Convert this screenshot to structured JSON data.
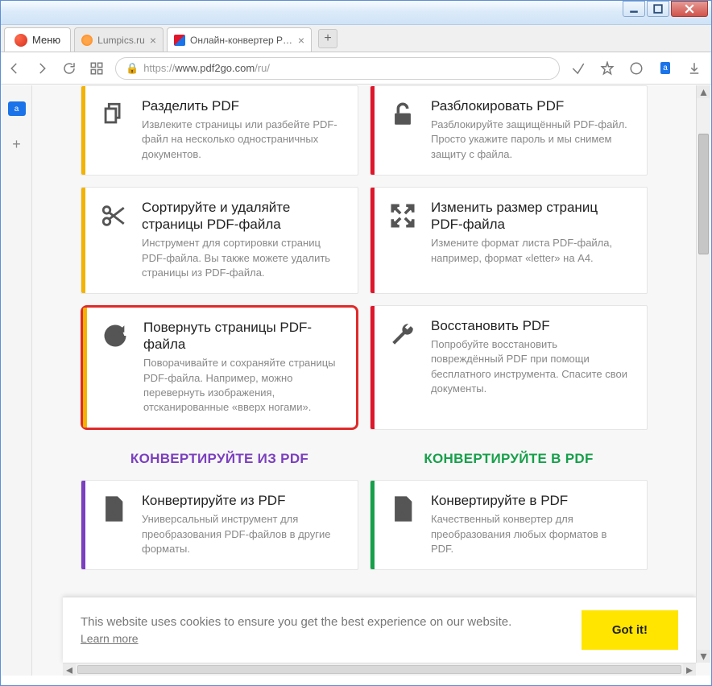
{
  "window": {
    "menu_label": "Меню"
  },
  "tabs": [
    {
      "title": "Lumpics.ru",
      "active": false
    },
    {
      "title": "Онлайн-конвертер PDF-д",
      "active": true
    }
  ],
  "address": {
    "scheme": "https://",
    "host": "www.pdf2go.com",
    "path": "/ru/"
  },
  "side_rail": {
    "badge": "a",
    "plus": "+"
  },
  "cards": [
    {
      "stripe": "#f4b300",
      "icon": "copy",
      "title": "Разделить PDF",
      "desc": "Извлеките страницы или разбейте PDF-файл на несколько одностраничных документов.",
      "highlight": false
    },
    {
      "stripe": "#e0162b",
      "icon": "unlock",
      "title": "Разблокировать PDF",
      "desc": "Разблокируйте защищённый PDF-файл. Просто укажите пароль и мы снимем защиту с файла.",
      "highlight": false
    },
    {
      "stripe": "#f4b300",
      "icon": "scissors",
      "title": "Сортируйте и удаляйте страницы PDF-файла",
      "desc": "Инструмент для сортировки страниц PDF-файла. Вы также можете удалить страницы из PDF-файла.",
      "highlight": false
    },
    {
      "stripe": "#e0162b",
      "icon": "expand",
      "title": "Изменить размер страниц PDF-файла",
      "desc": "Измените формат листа PDF-файла, например, формат «letter» на А4.",
      "highlight": false
    },
    {
      "stripe": "#f4b300",
      "icon": "rotate",
      "title": "Повернуть страницы PDF-файла",
      "desc": "Поворачивайте и сохраняйте страницы PDF-файла. Например, можно перевернуть изображения, отсканированные «вверх ногами».",
      "highlight": true
    },
    {
      "stripe": "#e0162b",
      "icon": "wrench",
      "title": "Восстановить PDF",
      "desc": "Попробуйте восстановить повреждённый PDF при помощи бесплатного инструмента. Спасите свои документы.",
      "highlight": false
    }
  ],
  "sections": {
    "from": "КОНВЕРТИРУЙТЕ ИЗ PDF",
    "to": "КОНВЕРТИРУЙТЕ В PDF"
  },
  "convert_cards": [
    {
      "stripe": "#7b3fbf",
      "icon": "pdf",
      "title": "Конвертируйте из PDF",
      "desc": "Универсальный инструмент для преобразования PDF-файлов в другие форматы."
    },
    {
      "stripe": "#16a04a",
      "icon": "pdf",
      "title": "Конвертируйте в PDF",
      "desc": "Качественный конвертер для преобразования любых форматов в PDF."
    }
  ],
  "cookie": {
    "message": "This website uses cookies to ensure you get the best experience on our website.",
    "learn_more": "Learn more",
    "button": "Got it!"
  }
}
